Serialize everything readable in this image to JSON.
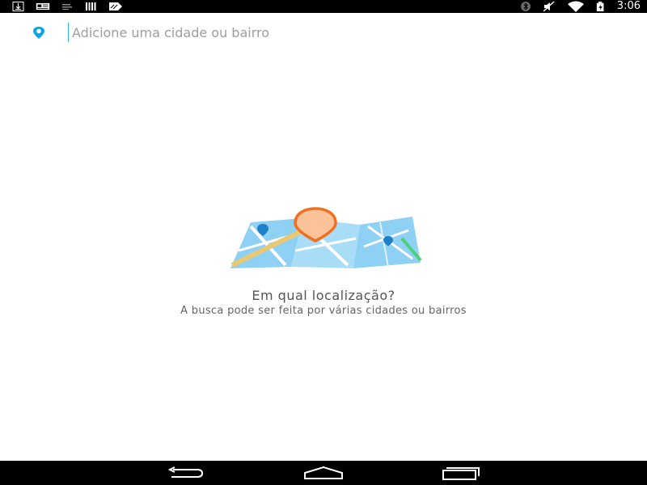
{
  "status_bar": {
    "time": "3:06",
    "left_icons": [
      "download-icon",
      "news-icon",
      "sim-icon",
      "barcode-icon",
      "tag-icon"
    ],
    "right_icons": [
      "bluetooth-icon",
      "vibrate-icon",
      "wifi-icon",
      "battery-icon"
    ]
  },
  "search": {
    "placeholder": "Adicione uma cidade ou bairro",
    "value": "",
    "icon": "location-pin-icon",
    "accent_color": "#0aa5e6"
  },
  "empty_state": {
    "title": "Em qual localização?",
    "subtitle": "A busca pode ser feita por várias cidades ou bairros",
    "illustration": "map-with-pin-illustration",
    "pin_color": "#f07020"
  },
  "nav_bar": {
    "icons": [
      "back-icon",
      "home-icon",
      "recent-apps-icon"
    ]
  }
}
